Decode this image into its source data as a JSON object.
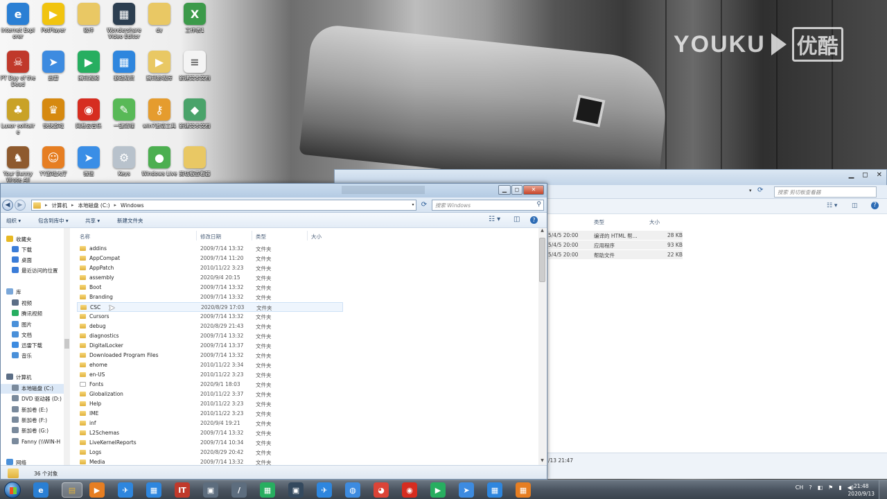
{
  "watermark": {
    "latin": "YOUKU",
    "cjk": "优酷"
  },
  "desktop_icons": [
    {
      "label": "Internet Explorer",
      "glyph": "e",
      "color": "#2a7fd4"
    },
    {
      "label": "PotPlayer",
      "glyph": "▶",
      "color": "#f1c40f"
    },
    {
      "label": "软件",
      "glyph": "",
      "color": "#e9c864"
    },
    {
      "label": "Wondershare Video Editor",
      "glyph": "▦",
      "color": "#2c3e50"
    },
    {
      "label": "dy",
      "glyph": "",
      "color": "#e9c864"
    },
    {
      "label": "工作表1",
      "glyph": "X",
      "color": "#3c9a4a"
    },
    {
      "label": "PT Day of the Dead",
      "glyph": "☠",
      "color": "#c0392b"
    },
    {
      "label": "迅雷",
      "glyph": "➤",
      "color": "#3d8be0"
    },
    {
      "label": "腾讯视频",
      "glyph": "▶",
      "color": "#27ae60"
    },
    {
      "label": "驱动精灵",
      "glyph": "▦",
      "color": "#2e86de"
    },
    {
      "label": "腾讯影视库",
      "glyph": "▶",
      "color": "#e9c864"
    },
    {
      "label": "新建文本文档",
      "glyph": "≡",
      "color": "#f4f4f4"
    },
    {
      "label": "Luxor solitaire",
      "glyph": "♣",
      "color": "#c9a227"
    },
    {
      "label": "快快游戏",
      "glyph": "♛",
      "color": "#d68910"
    },
    {
      "label": "网易云音乐",
      "glyph": "◉",
      "color": "#d62d20"
    },
    {
      "label": "一键清理",
      "glyph": "✎",
      "color": "#58b957"
    },
    {
      "label": "win7激活工具",
      "glyph": "⚷",
      "color": "#e59c2e"
    },
    {
      "label": "新建文本文档",
      "glyph": "◆",
      "color": "#4aa36a"
    },
    {
      "label": "Your Bunny Wrote All",
      "glyph": "♞",
      "color": "#8e5a2e"
    },
    {
      "label": "YY游戏大厅",
      "glyph": "☺",
      "color": "#e67e22"
    },
    {
      "label": "微信",
      "glyph": "➤",
      "color": "#3a8ee6"
    },
    {
      "label": "Keys",
      "glyph": "⚙",
      "color": "#b8c2cc"
    },
    {
      "label": "Windows Live",
      "glyph": "●",
      "color": "#4caf50"
    },
    {
      "label": "剪切板查看器",
      "glyph": "",
      "color": "#e9c864"
    }
  ],
  "back_window": {
    "search_placeholder": "搜索 剪切板查看器",
    "headers": [
      "类型",
      "大小"
    ],
    "rows": [
      {
        "date": "5/4/5 20:00",
        "type": "编译的 HTML 帮...",
        "size": "28 KB"
      },
      {
        "date": "5/4/5 20:00",
        "type": "应用程序",
        "size": "93 KB"
      },
      {
        "date": "5/4/5 20:00",
        "type": "帮助文件",
        "size": "22 KB"
      }
    ],
    "status": "/13 21:47"
  },
  "explorer": {
    "address": [
      "计算机",
      "本地磁盘 (C:)",
      "Windows"
    ],
    "search_placeholder": "搜索 Windows",
    "toolbar": {
      "organize": "组织 ▾",
      "include": "包含到库中 ▾",
      "share": "共享 ▾",
      "new_folder": "新建文件夹"
    },
    "nav": [
      {
        "label": "收藏夹",
        "kind": "star",
        "color": "#e8b923",
        "group": true
      },
      {
        "label": "下载",
        "kind": "item",
        "color": "#3b7dd8"
      },
      {
        "label": "桌面",
        "kind": "item",
        "color": "#3b7dd8"
      },
      {
        "label": "最近访问的位置",
        "kind": "item",
        "color": "#3b7dd8"
      },
      {
        "label": "库",
        "kind": "group",
        "color": "#7aa7d9",
        "group": true
      },
      {
        "label": "视频",
        "kind": "item",
        "color": "#5c6e86"
      },
      {
        "label": "腾讯视频",
        "kind": "item",
        "color": "#27ae60"
      },
      {
        "label": "图片",
        "kind": "item",
        "color": "#4a90d9"
      },
      {
        "label": "文档",
        "kind": "item",
        "color": "#4a90d9"
      },
      {
        "label": "迅雷下载",
        "kind": "item",
        "color": "#3d8be0"
      },
      {
        "label": "音乐",
        "kind": "item",
        "color": "#4a90d9"
      },
      {
        "label": "计算机",
        "kind": "group",
        "color": "#5c6e86",
        "group": true
      },
      {
        "label": "本地磁盘 (C:)",
        "kind": "item",
        "color": "#7a8a9c",
        "selected": true
      },
      {
        "label": "DVD 驱动器 (D:)",
        "kind": "item",
        "color": "#7a8a9c"
      },
      {
        "label": "新加卷 (E:)",
        "kind": "item",
        "color": "#7a8a9c"
      },
      {
        "label": "新加卷 (F:)",
        "kind": "item",
        "color": "#7a8a9c"
      },
      {
        "label": "新加卷 (G:)",
        "kind": "item",
        "color": "#7a8a9c"
      },
      {
        "label": "Fanny (\\\\WIN-H",
        "kind": "item",
        "color": "#7a8a9c"
      },
      {
        "label": "网络",
        "kind": "group",
        "color": "#4a90d9",
        "group": true
      }
    ],
    "columns": [
      "名称",
      "修改日期",
      "类型",
      "大小"
    ],
    "files": [
      {
        "name": "addins",
        "date": "2009/7/14 13:32",
        "type": "文件夹"
      },
      {
        "name": "AppCompat",
        "date": "2009/7/14 11:20",
        "type": "文件夹"
      },
      {
        "name": "AppPatch",
        "date": "2010/11/22 3:23",
        "type": "文件夹"
      },
      {
        "name": "assembly",
        "date": "2020/9/4 20:15",
        "type": "文件夹"
      },
      {
        "name": "Boot",
        "date": "2009/7/14 13:32",
        "type": "文件夹"
      },
      {
        "name": "Branding",
        "date": "2009/7/14 13:32",
        "type": "文件夹"
      },
      {
        "name": "CSC",
        "date": "2020/8/29 17:03",
        "type": "文件夹",
        "hover": true
      },
      {
        "name": "Cursors",
        "date": "2009/7/14 13:32",
        "type": "文件夹"
      },
      {
        "name": "debug",
        "date": "2020/8/29 21:43",
        "type": "文件夹"
      },
      {
        "name": "diagnostics",
        "date": "2009/7/14 13:32",
        "type": "文件夹"
      },
      {
        "name": "DigitalLocker",
        "date": "2009/7/14 13:37",
        "type": "文件夹"
      },
      {
        "name": "Downloaded Program Files",
        "date": "2009/7/14 13:32",
        "type": "文件夹"
      },
      {
        "name": "ehome",
        "date": "2010/11/22 3:34",
        "type": "文件夹"
      },
      {
        "name": "en-US",
        "date": "2010/11/22 3:23",
        "type": "文件夹"
      },
      {
        "name": "Fonts",
        "date": "2020/9/1 18:03",
        "type": "文件夹",
        "plain": true
      },
      {
        "name": "Globalization",
        "date": "2010/11/22 3:37",
        "type": "文件夹"
      },
      {
        "name": "Help",
        "date": "2010/11/22 3:23",
        "type": "文件夹"
      },
      {
        "name": "IME",
        "date": "2010/11/22 3:23",
        "type": "文件夹"
      },
      {
        "name": "inf",
        "date": "2020/9/4 19:21",
        "type": "文件夹"
      },
      {
        "name": "L2Schemas",
        "date": "2009/7/14 13:32",
        "type": "文件夹"
      },
      {
        "name": "LiveKernelReports",
        "date": "2009/7/14 10:34",
        "type": "文件夹"
      },
      {
        "name": "Logs",
        "date": "2020/8/29 20:42",
        "type": "文件夹"
      },
      {
        "name": "Media",
        "date": "2009/7/14 13:32",
        "type": "文件夹"
      }
    ],
    "status": "36 个对象"
  },
  "taskbar": {
    "apps": [
      {
        "name": "ie",
        "glyph": "e",
        "color": "#2a7fd4"
      },
      {
        "name": "explorer",
        "glyph": "▤",
        "color": "#e0b13c",
        "active": true
      },
      {
        "name": "media-player",
        "glyph": "▶",
        "color": "#e67e22"
      },
      {
        "name": "feiq",
        "glyph": "✈",
        "color": "#2e86de"
      },
      {
        "name": "app-5",
        "glyph": "▦",
        "color": "#2e86de"
      },
      {
        "name": "app-6",
        "glyph": "IT",
        "color": "#c0392b"
      },
      {
        "name": "app-7",
        "glyph": "▣",
        "color": "#5d6d7e"
      },
      {
        "name": "app-8",
        "glyph": "/",
        "color": "#5d6d7e"
      },
      {
        "name": "app-9",
        "glyph": "▦",
        "color": "#27ae60"
      },
      {
        "name": "app-10",
        "glyph": "▣",
        "color": "#34495e"
      },
      {
        "name": "app-11",
        "glyph": "✈",
        "color": "#2e86de"
      },
      {
        "name": "app-12",
        "glyph": "◍",
        "color": "#3d8be0"
      },
      {
        "name": "chrome",
        "glyph": "◕",
        "color": "#db4437"
      },
      {
        "name": "netease-music",
        "glyph": "◉",
        "color": "#d62d20"
      },
      {
        "name": "tencent-video",
        "glyph": "▶",
        "color": "#27ae60"
      },
      {
        "name": "thunder",
        "glyph": "➤",
        "color": "#3d8be0"
      },
      {
        "name": "app-17",
        "glyph": "▦",
        "color": "#2e86de"
      },
      {
        "name": "app-18",
        "glyph": "▦",
        "color": "#e67e22"
      }
    ],
    "tray": [
      "CH",
      "?",
      "◧",
      "⚑",
      "▮",
      "◀)"
    ],
    "time": "21:48",
    "date": "2020/9/13"
  }
}
